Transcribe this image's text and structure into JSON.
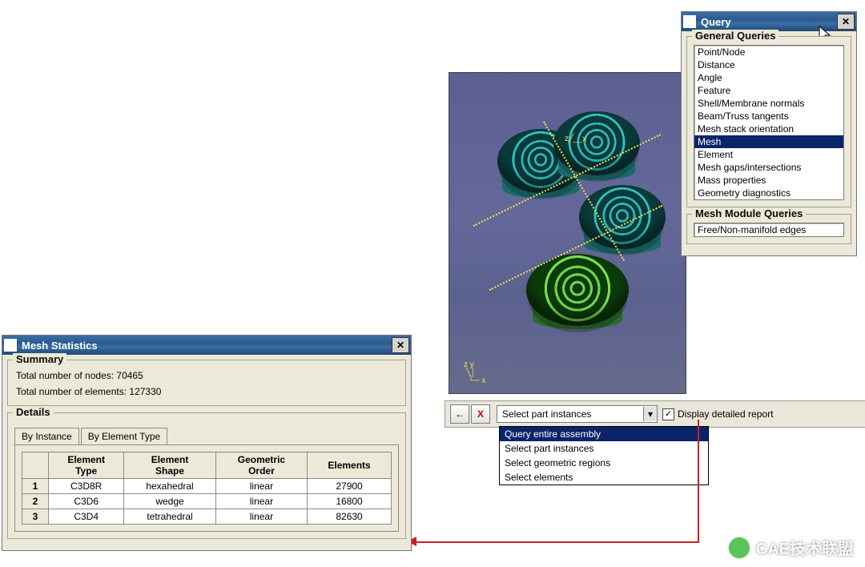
{
  "query_window": {
    "title": "Query",
    "groups": {
      "general": {
        "label": "General Queries"
      },
      "mesh": {
        "label": "Mesh Module Queries"
      }
    },
    "general_items": [
      "Point/Node",
      "Distance",
      "Angle",
      "Feature",
      "Shell/Membrane normals",
      "Beam/Truss tangents",
      "Mesh stack orientation",
      "Mesh",
      "Element",
      "Mesh gaps/intersections",
      "Mass properties",
      "Geometry diagnostics"
    ],
    "general_selected": "Mesh",
    "mesh_items": [
      "Free/Non-manifold edges"
    ]
  },
  "prompt": {
    "back": "←",
    "cancel": "X",
    "combo_value": "Select part instances",
    "options": [
      "Query entire assembly",
      "Select part instances",
      "Select geometric regions",
      "Select elements"
    ],
    "options_selected": "Query entire assembly",
    "checkbox_label": "Display detailed report",
    "checkbox_checked": "✓"
  },
  "stats_window": {
    "title": "Mesh Statistics",
    "summary": {
      "label": "Summary",
      "nodes_label": "Total number of nodes: 70465",
      "elements_label": "Total number of elements: 127330"
    },
    "details": {
      "label": "Details",
      "tabs": {
        "by_instance": "By Instance",
        "by_type": "By Element Type"
      },
      "headers": {
        "type": "Element\nType",
        "shape": "Element\nShape",
        "order": "Geometric\nOrder",
        "count": "Elements"
      },
      "rows": [
        {
          "n": "1",
          "type": "C3D8R",
          "shape": "hexahedral",
          "order": "linear",
          "count": "27900"
        },
        {
          "n": "2",
          "type": "C3D6",
          "shape": "wedge",
          "order": "linear",
          "count": "16800"
        },
        {
          "n": "3",
          "type": "C3D4",
          "shape": "tetrahedral",
          "order": "linear",
          "count": "82630"
        }
      ]
    }
  },
  "watermark": "CAE技术联盟"
}
